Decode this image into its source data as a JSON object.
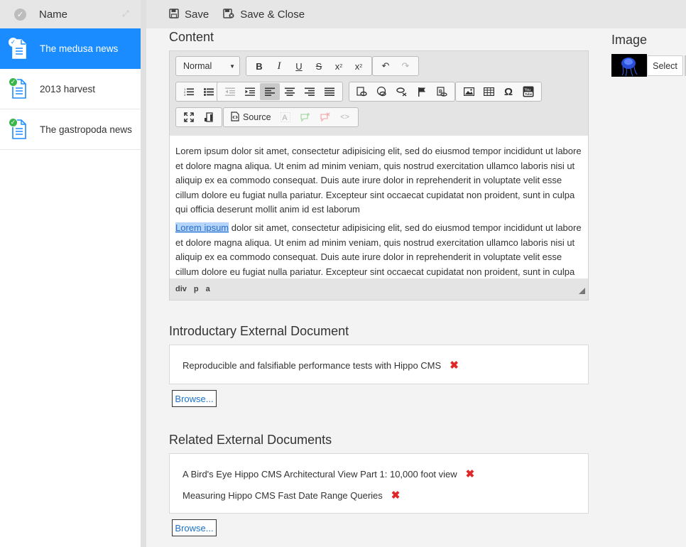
{
  "sidebar": {
    "header_label": "Name",
    "items": [
      {
        "label": "The medusa news",
        "active": true
      },
      {
        "label": "2013 harvest",
        "active": false
      },
      {
        "label": "The gastropoda news",
        "active": false
      }
    ]
  },
  "toolbar": {
    "save_label": "Save",
    "save_close_label": "Save & Close"
  },
  "content": {
    "title": "Content",
    "format_value": "Normal",
    "source_label": "Source",
    "paragraph1": "Lorem ipsum dolor sit amet, consectetur adipisicing elit, sed do eiusmod tempor incididunt ut labore et dolore magna aliqua. Ut enim ad minim veniam, quis nostrud exercitation ullamco laboris nisi ut aliquip ex ea commodo consequat. Duis aute irure dolor in reprehenderit in voluptate velit esse cillum dolore eu fugiat nulla pariatur. Excepteur sint occaecat cupidatat non proident, sunt in culpa qui officia deserunt mollit anim id est laborum",
    "paragraph2_link": "Lorem ipsum",
    "paragraph2_rest": " dolor sit amet, consectetur adipisicing elit, sed do eiusmod tempor incididunt ut labore et dolore magna aliqua. Ut enim ad minim veniam, quis nostrud exercitation ullamco laboris nisi ut aliquip ex ea commodo consequat. Duis aute irure dolor in reprehenderit in voluptate velit esse cillum dolore eu fugiat nulla pariatur. Excepteur sint occaecat cupidatat non proident, sunt in culpa qui officia deserunt mollit anim id est laborum",
    "path": [
      "div",
      "p",
      "a"
    ]
  },
  "intro_doc": {
    "title": "Introductary External Document",
    "items": [
      "Reproducible and falsifiable performance tests with Hippo CMS"
    ],
    "browse_label": "Browse..."
  },
  "related_docs": {
    "title": "Related External Documents",
    "items": [
      "A Bird's Eye Hippo CMS Architectural View Part 1: 10,000 foot view",
      "Measuring Hippo CMS Fast Date Range Queries"
    ],
    "browse_label": "Browse..."
  },
  "image": {
    "title": "Image",
    "select_label": "Select"
  },
  "colors": {
    "accent": "#1a8cff",
    "publish_badge": "#3cb54a",
    "delete": "#e02626",
    "link": "#1a73c9"
  }
}
